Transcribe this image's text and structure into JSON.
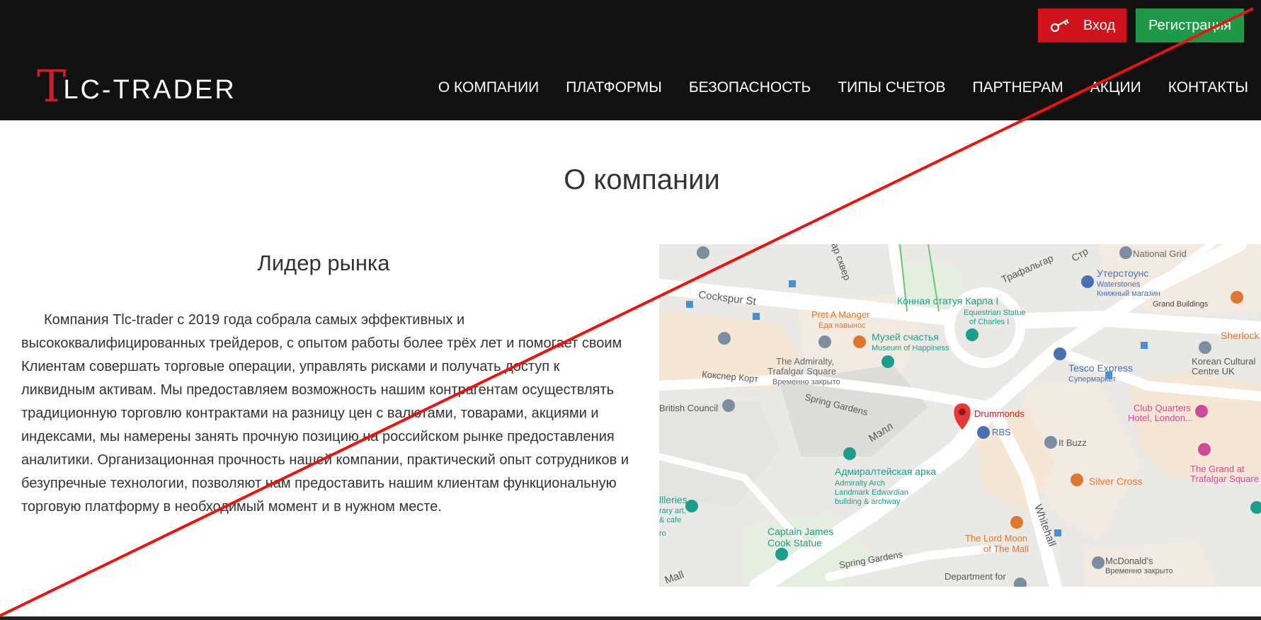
{
  "header": {
    "logo_initial": "T",
    "logo_rest": "LC-TRADER",
    "login_label": "Вход",
    "register_label": "Регистрация",
    "nav": [
      "О КОМПАНИИ",
      "ПЛАТФОРМЫ",
      "БЕЗОПАСНОСТЬ",
      "ТИПЫ СЧЕТОВ",
      "ПАРТНЕРАМ",
      "АКЦИИ",
      "КОНТАКТЫ"
    ]
  },
  "main": {
    "title": "О компании",
    "subtitle": "Лидер рынка",
    "paragraph": "Компания Tlc-trader с 2019 года собрала самых эффективных и высококвалифицированных трейдеров, с опытом работы более трёх лет и помогает своим Клиентам совершать торговые операции, управлять рисками и получать доступ к ликвидным активам. Мы предоставляем возможность нашим контрагентам осуществлять традиционную торговлю контрактами на разницу цен с валютами, товарами, акциями и индексами, мы намерены занять прочную позицию на российском рынке предоставления аналитики. Организационная прочность нашей компании, практический опыт сотрудников и безупречные технологии, позволяют нам предоставить нашим клиентам функциональную торговую платформу в необходимый момент и в нужном месте."
  },
  "map": {
    "labels": {
      "cockspur": "Cockspur St",
      "koksper": "Кокспер Корт",
      "spring1": "Spring Gardens",
      "spring2": "Spring Gardens",
      "mall_ru": "Мэлл",
      "mall": "Mall",
      "whitehall": "Whitehall",
      "trafalgar_sq": "Трафальгар",
      "skver": "ар сквер",
      "strand": "Стр",
      "pret": "Pret A Manger",
      "pret_sub": "Еда навынос",
      "charles": "Конная статуя Карла I",
      "charles_sub1": "Equestrian Statue",
      "charles_sub2": "of Charles I",
      "museum": "Музей счастья",
      "museum_sub": "Museum of Happiness",
      "admiralty": "The Admiralty,",
      "admiralty2": "Trafalgar Square",
      "admiralty_sub": "Временно закрыто",
      "british": "British Council",
      "drummonds": "Drummonds",
      "rbs": "RBS",
      "arch": "Адмиралтейская арка",
      "arch_sub1": "Admiralty Arch",
      "arch_sub2": "Landmark Edwardian",
      "arch_sub3": "building & archway",
      "cook": "Captain James",
      "cook2": "Cook Statue",
      "lordmoon": "The Lord Moon",
      "lordmoon2": "of The Mall",
      "national": "National Grid",
      "waterstones": "Утерстоунс",
      "waterstones_sub1": "Waterstones",
      "waterstones_sub2": "Книжный магазин",
      "grand_bld": "Grand Buildings",
      "sherlock": "Sherlock",
      "tesco": "Tesco Express",
      "tesco_sub": "Супермаркет",
      "korean": "Korean Cultural",
      "korean2": "Centre UK",
      "clubq": "Club Quarters",
      "clubq2": "Hotel, London...",
      "itbuzz": "It Buzz",
      "grand": "The Grand at",
      "grand2": "Trafalgar Square",
      "silver": "Silver Cross",
      "mcd": "McDonald's",
      "mcd_sub": "Временно закрыто",
      "dept": "Department for",
      "galleries": "llleries",
      "galleries2": "rary art,",
      "galleries3": "& cafe",
      "ro": "ro"
    }
  }
}
